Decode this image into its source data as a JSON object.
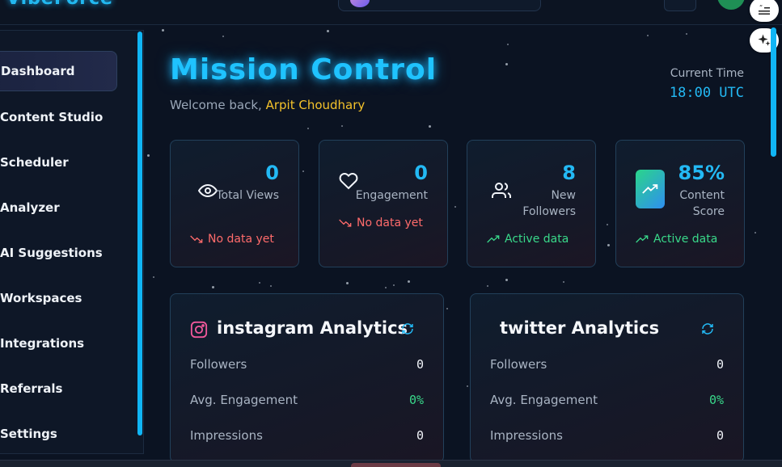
{
  "app": {
    "logo": "VibeForce"
  },
  "sidebar": {
    "items": [
      {
        "label": "Dashboard",
        "active": true
      },
      {
        "label": "Content Studio"
      },
      {
        "label": "Scheduler"
      },
      {
        "label": "Analyzer"
      },
      {
        "label": "AI Suggestions"
      },
      {
        "label": "Workspaces"
      },
      {
        "label": "Integrations"
      },
      {
        "label": "Referrals"
      },
      {
        "label": "Settings"
      }
    ]
  },
  "header": {
    "title": "Mission Control",
    "welcome_prefix": "Welcome back,",
    "user_name": "Arpit Choudhary",
    "time_label": "Current Time",
    "time_value": "18:00 UTC"
  },
  "stats": [
    {
      "value": "0",
      "label": "Total Views",
      "trend": "No data yet",
      "trend_type": "negative",
      "icon": "eye-icon"
    },
    {
      "value": "0",
      "label": "Engagement",
      "trend": "No data yet",
      "trend_type": "negative",
      "icon": "heart-icon"
    },
    {
      "value": "8",
      "label": "New Followers",
      "trend": "Active data",
      "trend_type": "positive",
      "icon": "users-icon"
    },
    {
      "value": "85%",
      "label": "Content Score",
      "trend": "Active data",
      "trend_type": "positive",
      "icon": "trending-up-icon"
    }
  ],
  "panels": [
    {
      "title": "instagram Analytics",
      "rows": [
        {
          "label": "Followers",
          "value": "0"
        },
        {
          "label": "Avg. Engagement",
          "value": "0%"
        },
        {
          "label": "Impressions",
          "value": "0"
        }
      ]
    },
    {
      "title": "twitter Analytics",
      "rows": [
        {
          "label": "Followers",
          "value": "0"
        },
        {
          "label": "Avg. Engagement",
          "value": "0%"
        },
        {
          "label": "Impressions",
          "value": "0"
        }
      ]
    }
  ],
  "colors": {
    "accent": "#23b9f4",
    "highlight": "#f4c22b",
    "positive": "#39d98a",
    "negative": "#ff6b6b"
  }
}
